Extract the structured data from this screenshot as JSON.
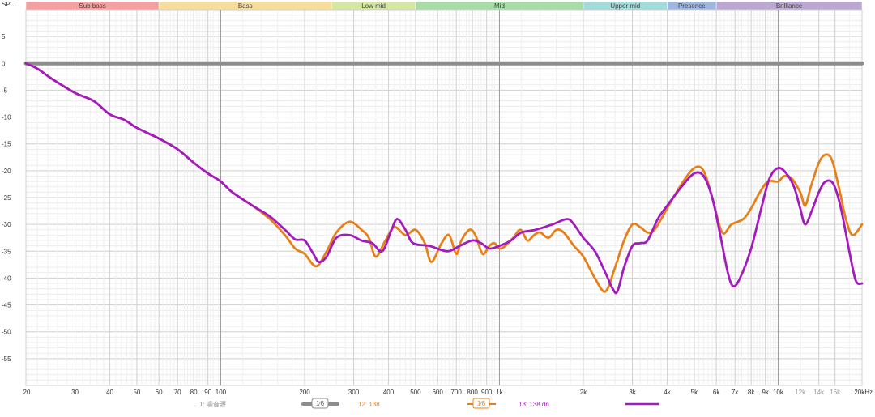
{
  "chart_data": {
    "type": "line",
    "ylabel": "SPL",
    "x_scale": "log",
    "xlim": [
      20,
      20000
    ],
    "ylim": [
      -60,
      10
    ],
    "y_ticks": [
      5,
      0,
      -5,
      -10,
      -15,
      -20,
      -25,
      -30,
      -35,
      -40,
      -45,
      -50,
      -55
    ],
    "x_ticks": [
      {
        "v": 20,
        "t": "20",
        "major": false
      },
      {
        "v": 30,
        "t": "30",
        "major": false
      },
      {
        "v": 40,
        "t": "40",
        "major": false
      },
      {
        "v": 50,
        "t": "50",
        "major": false
      },
      {
        "v": 60,
        "t": "60",
        "major": false
      },
      {
        "v": 70,
        "t": "70",
        "major": false
      },
      {
        "v": 80,
        "t": "80",
        "major": false
      },
      {
        "v": 90,
        "t": "90",
        "major": false
      },
      {
        "v": 100,
        "t": "100",
        "major": true
      },
      {
        "v": 200,
        "t": "200",
        "major": false
      },
      {
        "v": 300,
        "t": "300",
        "major": false
      },
      {
        "v": 400,
        "t": "400",
        "major": false
      },
      {
        "v": 500,
        "t": "500",
        "major": false
      },
      {
        "v": 600,
        "t": "600",
        "major": false
      },
      {
        "v": 700,
        "t": "700",
        "major": false
      },
      {
        "v": 800,
        "t": "800",
        "major": false
      },
      {
        "v": 900,
        "t": "900",
        "major": false
      },
      {
        "v": 1000,
        "t": "1k",
        "major": true
      },
      {
        "v": 2000,
        "t": "2k",
        "major": false
      },
      {
        "v": 3000,
        "t": "3k",
        "major": false
      },
      {
        "v": 4000,
        "t": "4k",
        "major": false
      },
      {
        "v": 5000,
        "t": "5k",
        "major": false
      },
      {
        "v": 6000,
        "t": "6k",
        "major": false
      },
      {
        "v": 7000,
        "t": "7k",
        "major": false
      },
      {
        "v": 8000,
        "t": "8k",
        "major": false
      },
      {
        "v": 9000,
        "t": "9k",
        "major": false
      },
      {
        "v": 10000,
        "t": "10k",
        "major": true
      },
      {
        "v": 12000,
        "t": "12k",
        "major": false,
        "faint": true
      },
      {
        "v": 14000,
        "t": "14k",
        "major": false,
        "faint": true
      },
      {
        "v": 16000,
        "t": "16k",
        "major": false,
        "faint": true
      },
      {
        "v": 20000,
        "t": "20kHz",
        "major": false
      }
    ],
    "bands": [
      {
        "name": "Sub bass",
        "from": 20,
        "to": 60,
        "color": "#f4a0a0"
      },
      {
        "name": "Bass",
        "from": 60,
        "to": 250,
        "color": "#f7dc9b"
      },
      {
        "name": "Low mid",
        "from": 250,
        "to": 500,
        "color": "#d5e7a3"
      },
      {
        "name": "Mid",
        "from": 500,
        "to": 2000,
        "color": "#a7dca6"
      },
      {
        "name": "Upper mid",
        "from": 2000,
        "to": 4000,
        "color": "#a2dbd9"
      },
      {
        "name": "Presence",
        "from": 4000,
        "to": 6000,
        "color": "#9fb7e0"
      },
      {
        "name": "Brilliance",
        "from": 6000,
        "to": 20000,
        "color": "#baa8d2"
      }
    ],
    "series": [
      {
        "name": "1: 噪音源",
        "color": "#8c8c8c",
        "points": [
          [
            20,
            0
          ],
          [
            20000,
            0
          ]
        ]
      },
      {
        "name": "12: 138",
        "color": "#e8801a",
        "points": [
          [
            20,
            0
          ],
          [
            22,
            -1
          ],
          [
            25,
            -3
          ],
          [
            30,
            -5.5
          ],
          [
            35,
            -7
          ],
          [
            40,
            -9.5
          ],
          [
            45,
            -10.5
          ],
          [
            50,
            -12
          ],
          [
            60,
            -14
          ],
          [
            70,
            -16
          ],
          [
            80,
            -18.5
          ],
          [
            90,
            -20.5
          ],
          [
            100,
            -22
          ],
          [
            110,
            -24
          ],
          [
            130,
            -26.5
          ],
          [
            150,
            -29
          ],
          [
            170,
            -32
          ],
          [
            185,
            -34.5
          ],
          [
            200,
            -35.5
          ],
          [
            220,
            -37.8
          ],
          [
            240,
            -35
          ],
          [
            260,
            -31.5
          ],
          [
            290,
            -29.5
          ],
          [
            320,
            -31
          ],
          [
            340,
            -32.5
          ],
          [
            360,
            -36
          ],
          [
            390,
            -33
          ],
          [
            420,
            -30.5
          ],
          [
            460,
            -32
          ],
          [
            500,
            -31
          ],
          [
            540,
            -33.5
          ],
          [
            570,
            -37
          ],
          [
            620,
            -33.5
          ],
          [
            660,
            -32
          ],
          [
            700,
            -35.5
          ],
          [
            730,
            -33
          ],
          [
            780,
            -31
          ],
          [
            820,
            -32
          ],
          [
            870,
            -35.5
          ],
          [
            920,
            -34
          ],
          [
            960,
            -33.5
          ],
          [
            1000,
            -34.5
          ],
          [
            1050,
            -34
          ],
          [
            1120,
            -32.5
          ],
          [
            1190,
            -31
          ],
          [
            1260,
            -33
          ],
          [
            1330,
            -32
          ],
          [
            1400,
            -31.5
          ],
          [
            1500,
            -32.5
          ],
          [
            1600,
            -31
          ],
          [
            1700,
            -31.5
          ],
          [
            1850,
            -34
          ],
          [
            2000,
            -36
          ],
          [
            2200,
            -40
          ],
          [
            2400,
            -42.5
          ],
          [
            2600,
            -38
          ],
          [
            2800,
            -33
          ],
          [
            3000,
            -30
          ],
          [
            3200,
            -30.5
          ],
          [
            3400,
            -31.5
          ],
          [
            3600,
            -31
          ],
          [
            4000,
            -27
          ],
          [
            4500,
            -22.5
          ],
          [
            5000,
            -19.5
          ],
          [
            5400,
            -20
          ],
          [
            5800,
            -25
          ],
          [
            6300,
            -31.5
          ],
          [
            6800,
            -30
          ],
          [
            7500,
            -29
          ],
          [
            8000,
            -27
          ],
          [
            8600,
            -24
          ],
          [
            9200,
            -22
          ],
          [
            10000,
            -22
          ],
          [
            10500,
            -21
          ],
          [
            11200,
            -21.5
          ],
          [
            12000,
            -24
          ],
          [
            12500,
            -26.5
          ],
          [
            13100,
            -23
          ],
          [
            14000,
            -18.5
          ],
          [
            14800,
            -17
          ],
          [
            15600,
            -18
          ],
          [
            16500,
            -23
          ],
          [
            17500,
            -29
          ],
          [
            18500,
            -32
          ],
          [
            20000,
            -30
          ]
        ]
      },
      {
        "name": "18: 138 dn",
        "color": "#a31bbf",
        "points": [
          [
            20,
            0
          ],
          [
            22,
            -1
          ],
          [
            25,
            -3
          ],
          [
            30,
            -5.5
          ],
          [
            35,
            -7
          ],
          [
            40,
            -9.5
          ],
          [
            45,
            -10.5
          ],
          [
            50,
            -12
          ],
          [
            60,
            -14
          ],
          [
            70,
            -16
          ],
          [
            80,
            -18.5
          ],
          [
            90,
            -20.5
          ],
          [
            100,
            -22
          ],
          [
            110,
            -24
          ],
          [
            130,
            -26.5
          ],
          [
            150,
            -28.5
          ],
          [
            170,
            -31
          ],
          [
            185,
            -32.8
          ],
          [
            200,
            -33
          ],
          [
            215,
            -35.5
          ],
          [
            225,
            -37
          ],
          [
            240,
            -36
          ],
          [
            260,
            -32.5
          ],
          [
            290,
            -32
          ],
          [
            320,
            -33
          ],
          [
            350,
            -33.5
          ],
          [
            380,
            -35
          ],
          [
            410,
            -31
          ],
          [
            430,
            -29
          ],
          [
            460,
            -31
          ],
          [
            490,
            -33.5
          ],
          [
            560,
            -34
          ],
          [
            650,
            -35
          ],
          [
            720,
            -34
          ],
          [
            800,
            -33
          ],
          [
            860,
            -33.5
          ],
          [
            920,
            -34.5
          ],
          [
            1000,
            -34
          ],
          [
            1100,
            -33
          ],
          [
            1200,
            -31.5
          ],
          [
            1350,
            -31
          ],
          [
            1550,
            -30
          ],
          [
            1750,
            -29
          ],
          [
            1850,
            -30
          ],
          [
            2000,
            -32.5
          ],
          [
            2200,
            -35
          ],
          [
            2400,
            -39
          ],
          [
            2550,
            -42
          ],
          [
            2650,
            -42.5
          ],
          [
            2800,
            -38
          ],
          [
            3000,
            -34
          ],
          [
            3200,
            -33.5
          ],
          [
            3400,
            -33
          ],
          [
            3700,
            -29
          ],
          [
            4000,
            -26.5
          ],
          [
            4500,
            -23
          ],
          [
            5000,
            -20.5
          ],
          [
            5400,
            -21
          ],
          [
            5800,
            -25
          ],
          [
            6200,
            -32
          ],
          [
            6600,
            -39
          ],
          [
            6900,
            -41.5
          ],
          [
            7300,
            -40
          ],
          [
            8000,
            -34.5
          ],
          [
            8700,
            -27
          ],
          [
            9300,
            -21.5
          ],
          [
            10000,
            -19.5
          ],
          [
            10700,
            -20.5
          ],
          [
            11400,
            -23
          ],
          [
            12000,
            -27
          ],
          [
            12500,
            -30
          ],
          [
            13200,
            -27.5
          ],
          [
            14000,
            -24
          ],
          [
            14800,
            -22
          ],
          [
            15800,
            -22.5
          ],
          [
            16800,
            -27
          ],
          [
            18000,
            -35
          ],
          [
            19000,
            -40.5
          ],
          [
            20000,
            -41
          ]
        ]
      }
    ],
    "legend": {
      "position": "bottom",
      "items": [
        {
          "label": "1: 噪音源",
          "swatch": "1/6-pill",
          "swatch_label": "1⁄6",
          "color": "#8c8c8c"
        },
        {
          "label": "12: 138",
          "swatch": "1/6-box",
          "swatch_label": "1⁄6",
          "color": "#e8801a"
        },
        {
          "label": "18: 138 dn",
          "swatch": "line",
          "color": "#a31bbf"
        }
      ]
    }
  }
}
